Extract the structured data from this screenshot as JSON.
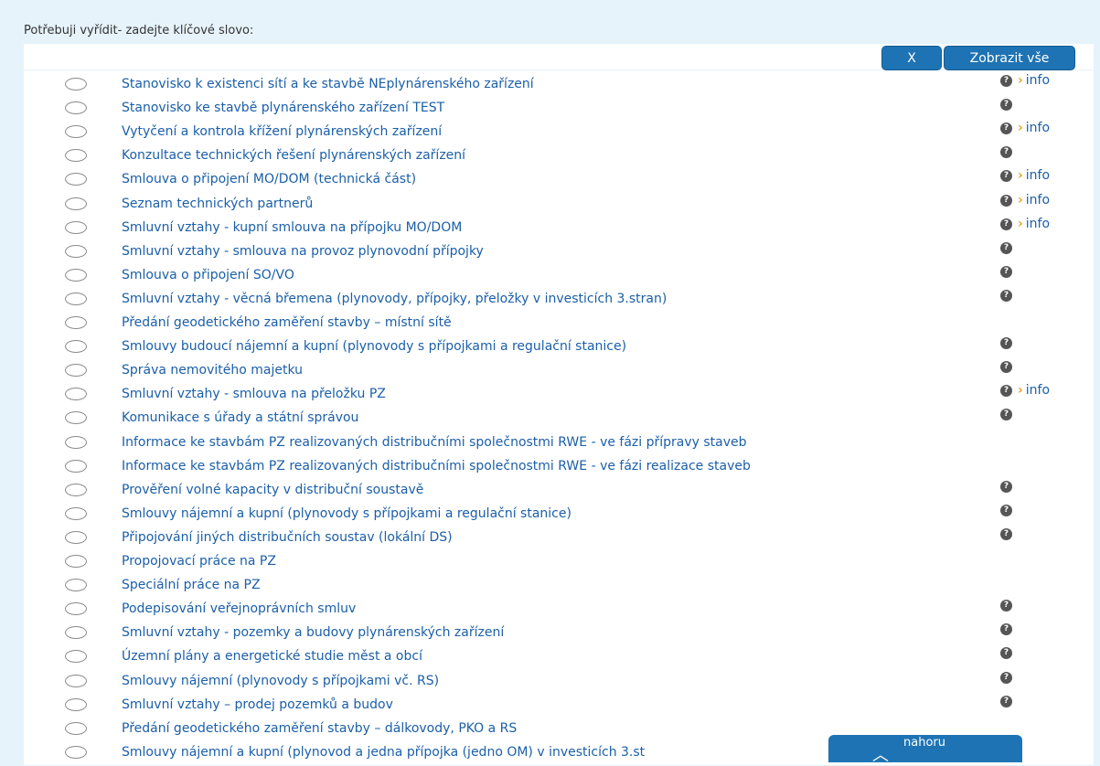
{
  "header": {
    "label": "Potřebuji vyřídit- zadejte klíčové slovo:"
  },
  "search": {
    "value": ""
  },
  "toolbar": {
    "clear_label": "X",
    "show_all_label": "Zobrazit vše"
  },
  "info_label": "info",
  "help_symbol": "?",
  "top_button": {
    "label": "nahoru"
  },
  "items": [
    {
      "label": "Stanovisko k existenci sítí a ke stavbě NEplynárenského zařízení",
      "help": true,
      "info": true
    },
    {
      "label": "Stanovisko ke stavbě plynárenského zařízení TEST",
      "help": true,
      "info": false
    },
    {
      "label": "Vytyčení a kontrola křížení plynárenských zařízení",
      "help": true,
      "info": true
    },
    {
      "label": "Konzultace technických řešení plynárenských zařízení",
      "help": true,
      "info": false
    },
    {
      "label": "Smlouva o připojení MO/DOM (technická část)",
      "help": true,
      "info": true
    },
    {
      "label": "Seznam technických partnerů",
      "help": true,
      "info": true
    },
    {
      "label": "Smluvní vztahy - kupní smlouva na přípojku MO/DOM",
      "help": true,
      "info": true
    },
    {
      "label": "Smluvní vztahy - smlouva na provoz plynovodní přípojky",
      "help": true,
      "info": false
    },
    {
      "label": "Smlouva o připojení SO/VO",
      "help": true,
      "info": false
    },
    {
      "label": "Smluvní vztahy - věcná břemena (plynovody, přípojky, přeložky v investicích 3.stran)",
      "help": true,
      "info": false
    },
    {
      "label": "Předání geodetického zaměření stavby – místní sítě",
      "help": false,
      "info": false
    },
    {
      "label": "Smlouvy budoucí nájemní a kupní (plynovody s přípojkami a regulační stanice)",
      "help": true,
      "info": false
    },
    {
      "label": "Správa nemovitého majetku",
      "help": true,
      "info": false
    },
    {
      "label": "Smluvní vztahy - smlouva na přeložku PZ",
      "help": true,
      "info": true
    },
    {
      "label": "Komunikace s úřady a státní správou",
      "help": true,
      "info": false
    },
    {
      "label": "Informace ke stavbám PZ realizovaných distribučními společnostmi RWE - ve fázi přípravy staveb",
      "help": false,
      "info": false
    },
    {
      "label": "Informace ke stavbám PZ realizovaných distribučními společnostmi RWE - ve fázi realizace staveb",
      "help": false,
      "info": false
    },
    {
      "label": "Prověření volné kapacity v distribuční soustavě",
      "help": true,
      "info": false
    },
    {
      "label": "Smlouvy nájemní a kupní (plynovody s přípojkami a regulační stanice)",
      "help": true,
      "info": false
    },
    {
      "label": "Připojování jiných distribučních soustav (lokální DS)",
      "help": true,
      "info": false
    },
    {
      "label": "Propojovací práce na PZ",
      "help": false,
      "info": false
    },
    {
      "label": "Speciální práce na PZ",
      "help": false,
      "info": false
    },
    {
      "label": "Podepisování veřejnoprávních smluv",
      "help": true,
      "info": false
    },
    {
      "label": "Smluvní vztahy - pozemky a budovy plynárenských zařízení",
      "help": true,
      "info": false
    },
    {
      "label": "Územní plány a energetické studie měst a obcí",
      "help": true,
      "info": false
    },
    {
      "label": "Smlouvy nájemní (plynovody s přípojkami vč. RS)",
      "help": true,
      "info": false
    },
    {
      "label": "Smluvní vztahy – prodej pozemků a budov",
      "help": true,
      "info": false
    },
    {
      "label": "Předání geodetického zaměření stavby – dálkovody, PKO a RS",
      "help": false,
      "info": false
    },
    {
      "label": "Smlouvy nájemní a kupní (plynovod a jedna přípojka (jedno OM) v investicích 3.st",
      "help": false,
      "info": false
    }
  ]
}
